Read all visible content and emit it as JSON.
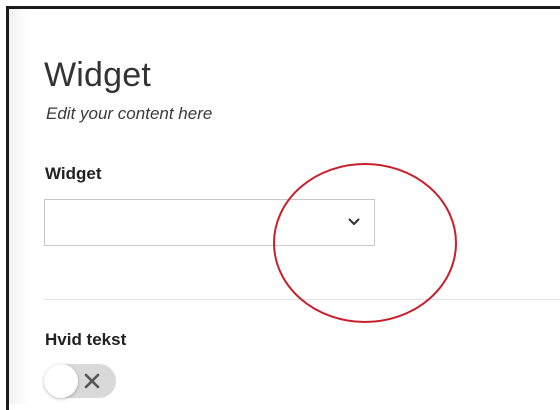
{
  "header": {
    "title": "Widget",
    "subtitle": "Edit your content here"
  },
  "widget_field": {
    "label": "Widget",
    "selected_value": ""
  },
  "toggle_field": {
    "label": "Hvid tekst",
    "state": "off"
  },
  "colors": {
    "annotation_circle": "#c8202a",
    "toggle_track": "#d9d9d9",
    "frame_border": "#1a1a1a"
  },
  "icons": {
    "dropdown": "chevron-down-icon",
    "toggle_off": "close-icon"
  }
}
